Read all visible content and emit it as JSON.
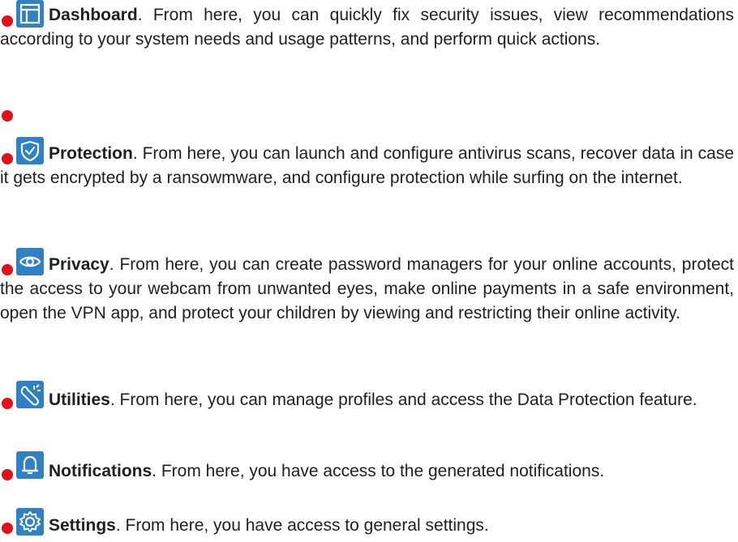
{
  "colors": {
    "bullet": "#e3101c",
    "icon_bg": "#2f80c4",
    "text": "#1f1f1f"
  },
  "items": [
    {
      "icon": "dashboard-icon",
      "title": "Dashboard",
      "description": ". From here, you can quickly fix security issues, view recommendations according to your system needs and usage patterns, and perform quick actions."
    },
    {
      "icon": "",
      "title": "",
      "description": ""
    },
    {
      "icon": "shield-check-icon",
      "title": "Protection",
      "description": ". From here, you can launch and configure antivirus scans, recover data in case it gets encrypted by a ransowmware, and configure protection while surfing on the internet."
    },
    {
      "icon": "eye-icon",
      "title": "Privacy",
      "description": ". From here, you can create password managers for your online accounts, protect the access to your webcam from unwanted eyes, make online payments in a safe environment, open the VPN app, and protect your children by viewing and restricting their online activity."
    },
    {
      "icon": "utilities-icon",
      "title": "Utilities",
      "description": ". From here, you can manage profiles and access the Data Protection feature."
    },
    {
      "icon": "bell-icon",
      "title": "Notifications",
      "description": ". From here, you have access to the generated notifications."
    },
    {
      "icon": "gear-icon",
      "title": "Settings",
      "description": ". From here, you have access to general settings."
    }
  ]
}
